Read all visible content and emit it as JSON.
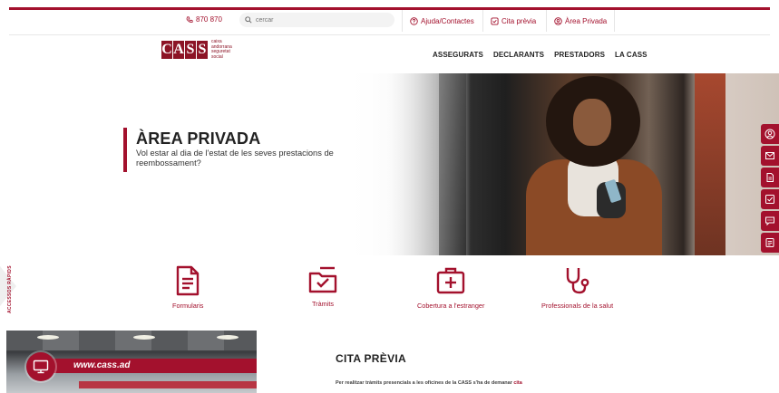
{
  "topbar": {
    "phone": "870 870",
    "search_placeholder": "cercar",
    "links": [
      {
        "label": "Ajuda/Contactes",
        "icon": "help-circle-icon"
      },
      {
        "label": "Cita prèvia",
        "icon": "calendar-check-icon"
      },
      {
        "label": "Àrea Privada",
        "icon": "user-circle-icon"
      }
    ]
  },
  "logo": {
    "letters": [
      "C",
      "A",
      "S",
      "S"
    ],
    "lines": [
      "caixa",
      "andorrana",
      "seguretat",
      "social"
    ]
  },
  "nav": {
    "items": [
      "ASSEGURATS",
      "DECLARANTS",
      "PRESTADORS",
      "LA CASS"
    ]
  },
  "hero": {
    "title": "ÀREA PRIVADA",
    "subtitle": "Vol estar al dia de l'estat de les seves prestacions de reembossament?"
  },
  "side_rail": [
    "user-icon",
    "mail-icon",
    "document-icon",
    "checklist-icon",
    "chat-icon",
    "form-icon"
  ],
  "quick_access": {
    "label": "ACCESSOS RÀPIDS",
    "items": [
      {
        "label": "Formularis",
        "icon": "form-document-icon"
      },
      {
        "label": "Tràmits",
        "icon": "folder-check-icon"
      },
      {
        "label": "Cobertura a l'estranger",
        "icon": "medical-bag-icon"
      },
      {
        "label": "Professionals de la salut",
        "icon": "stethoscope-icon"
      }
    ]
  },
  "promo": {
    "banner": "www.cass.ad",
    "icon": "monitor-icon"
  },
  "cita": {
    "title": "CITA PRÈVIA",
    "text": "Per realitzar tràmits presencials a les oficines de la CASS s'ha de demanar ",
    "highlight": "cita"
  },
  "colors": {
    "brand": "#a3112d",
    "logo": "#8c1426"
  }
}
